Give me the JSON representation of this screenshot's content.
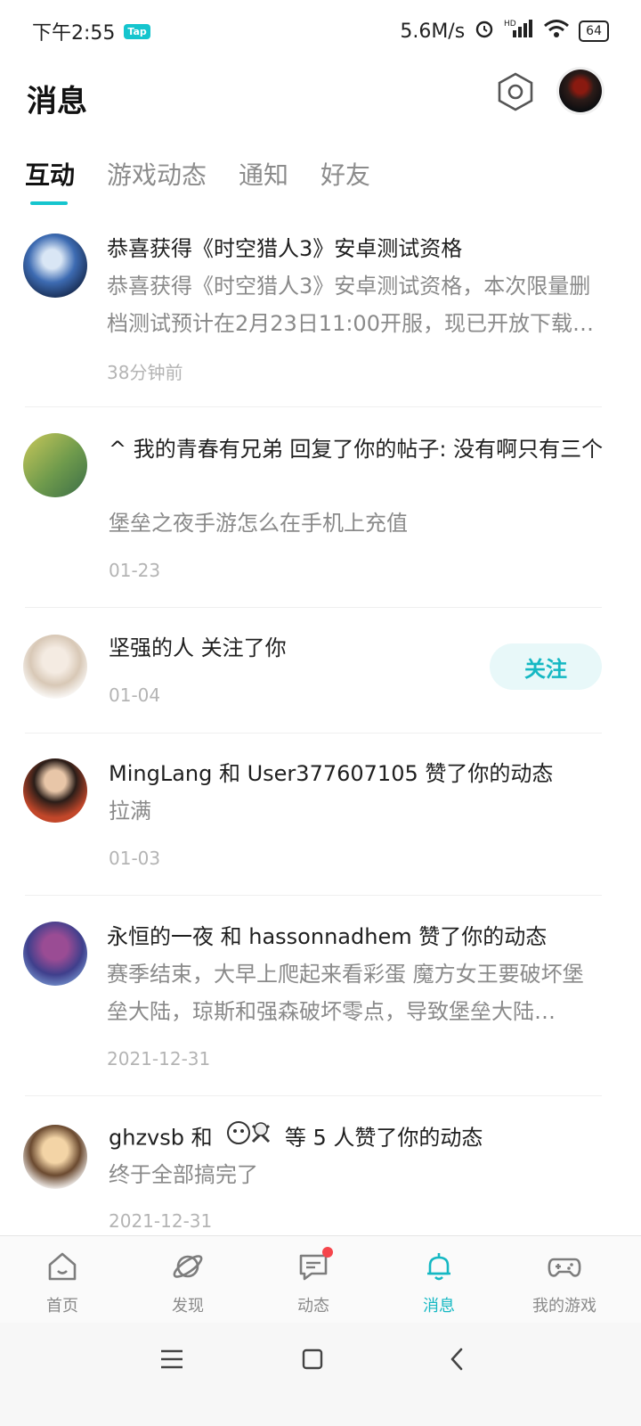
{
  "status_bar": {
    "time": "下午2:55",
    "tap_badge": "Tap",
    "speed": "5.6M/s",
    "network": "HD",
    "battery": "64"
  },
  "header": {
    "title": "消息"
  },
  "tabs": [
    {
      "label": "互动",
      "active": true
    },
    {
      "label": "游戏动态",
      "active": false
    },
    {
      "label": "通知",
      "active": false
    },
    {
      "label": "好友",
      "active": false
    }
  ],
  "messages": [
    {
      "title": "恭喜获得《时空猎人3》安卓测试资格",
      "body": "恭喜获得《时空猎人3》安卓测试资格，本次限量删档测试预计在2月23日11:00开服，现已开放下载…",
      "time": "38分钟前"
    },
    {
      "title": "^ 我的青春有兄弟 回复了你的帖子: 没有啊只有三个",
      "body": "堡垒之夜手游怎么在手机上充值",
      "time": "01-23"
    },
    {
      "title": "坚强的人 关注了你",
      "time": "01-04",
      "action": "关注"
    },
    {
      "title": "MingLang 和 User377607105 赞了你的动态",
      "body": "拉满",
      "time": "01-03"
    },
    {
      "title": "永恒的一夜 和 hassonnadhem 赞了你的动态",
      "body": "赛季结束，大早上爬起来看彩蛋 魔方女王要破坏堡垒大陆，琼斯和强森破坏零点，导致堡垒大陆…",
      "time": "2021-12-31"
    },
    {
      "title_prefix": "ghzvsb 和",
      "title_suffix": "等 5 人赞了你的动态",
      "body": "终于全部搞完了",
      "time": "2021-12-31"
    }
  ],
  "bottom_nav": [
    {
      "label": "首页",
      "icon": "home-icon"
    },
    {
      "label": "发现",
      "icon": "discover-planet-icon"
    },
    {
      "label": "动态",
      "icon": "feed-chat-icon"
    },
    {
      "label": "消息",
      "icon": "bell-icon",
      "active": true
    },
    {
      "label": "我的游戏",
      "icon": "gamepad-icon"
    }
  ],
  "colors": {
    "accent": "#15c5ce",
    "badge_red": "#f5454b"
  }
}
